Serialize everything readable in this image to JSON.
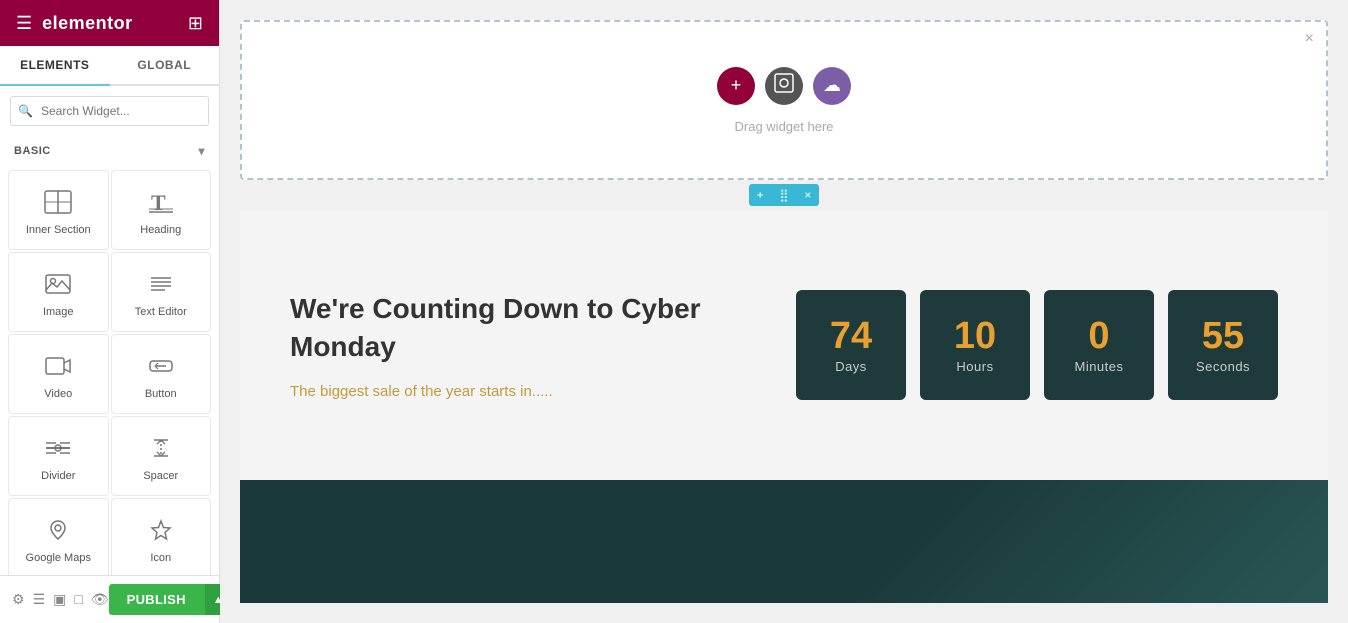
{
  "sidebar": {
    "logo": "elementor",
    "tabs": [
      {
        "label": "ELEMENTS",
        "active": true
      },
      {
        "label": "GLOBAL",
        "active": false
      }
    ],
    "search_placeholder": "Search Widget...",
    "section_label": "BASIC",
    "widgets": [
      {
        "icon": "inner_section",
        "label": "Inner Section"
      },
      {
        "icon": "heading",
        "label": "Heading"
      },
      {
        "icon": "image",
        "label": "Image"
      },
      {
        "icon": "text_editor",
        "label": "Text Editor"
      },
      {
        "icon": "video",
        "label": "Video"
      },
      {
        "icon": "button",
        "label": "Button"
      },
      {
        "icon": "divider",
        "label": "Divider"
      },
      {
        "icon": "spacer",
        "label": "Spacer"
      },
      {
        "icon": "map",
        "label": "Google Maps"
      },
      {
        "icon": "star",
        "label": "Icon"
      }
    ],
    "publish_label": "PUBLISH",
    "arrow_label": "▲"
  },
  "canvas": {
    "drop_zone": {
      "drag_text": "Drag widget here",
      "close_icon": "×",
      "add_icon": "+",
      "layout_icon": "▣",
      "widget_icon": "☁"
    },
    "row_toolbar": {
      "add_icon": "+",
      "move_icon": "⣿",
      "close_icon": "×"
    },
    "countdown": {
      "heading": "We're Counting Down to Cyber Monday",
      "subtext": "The biggest sale of the year starts in.....",
      "timers": [
        {
          "value": "74",
          "label": "Days"
        },
        {
          "value": "10",
          "label": "Hours"
        },
        {
          "value": "0",
          "label": "Minutes"
        },
        {
          "value": "55",
          "label": "Seconds"
        }
      ]
    }
  },
  "colors": {
    "accent_red": "#92003b",
    "accent_teal": "#39b8d6",
    "timer_bg": "#1e3a3a",
    "timer_number": "#e8a030",
    "publish_green": "#39b54a"
  }
}
